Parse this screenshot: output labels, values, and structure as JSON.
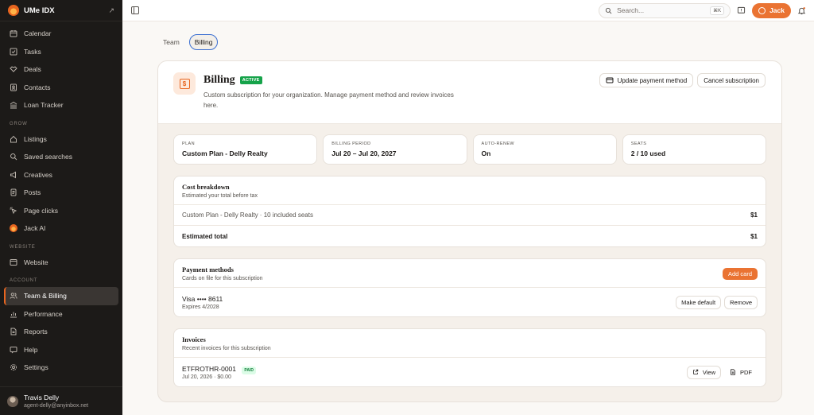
{
  "sidebar": {
    "brand": "UMe IDX",
    "items_main": [
      "Calendar",
      "Tasks",
      "Deals",
      "Contacts",
      "Loan Tracker"
    ],
    "section_grow": "GROW",
    "items_grow": [
      "Listings",
      "Saved searches",
      "Creatives",
      "Posts",
      "Page clicks",
      "Jack AI"
    ],
    "section_website": "WEBSITE",
    "items_website": [
      "Website"
    ],
    "section_account": "ACCOUNT",
    "items_account": [
      "Team & Billing",
      "Performance",
      "Reports",
      "Help",
      "Settings"
    ],
    "user": {
      "name": "Travis Delly",
      "email": "agent-delly@anyinbox.net"
    }
  },
  "topbar": {
    "search_placeholder": "Search...",
    "search_shortcut": "⌘K",
    "jack_label": "Jack"
  },
  "tabs": [
    "Team",
    "Billing"
  ],
  "billing": {
    "title": "Billing",
    "status": "ACTIVE",
    "subtitle": "Custom subscription for your organization. Manage payment method and review invoices here.",
    "update_btn": "Update payment method",
    "cancel_btn": "Cancel subscription",
    "stats": [
      {
        "label": "PLAN",
        "value": "Custom Plan - Delly Realty"
      },
      {
        "label": "BILLING PERIOD",
        "value": "Jul 20 – Jul 20, 2027"
      },
      {
        "label": "AUTO-RENEW",
        "value": "On"
      },
      {
        "label": "SEATS",
        "value": "2 / 10 used"
      }
    ],
    "cost": {
      "title": "Cost breakdown",
      "subtitle": "Estimated your total before tax",
      "line_label": "Custom Plan - Delly Realty · 10 included seats",
      "line_value": "$1",
      "total_label": "Estimated total",
      "total_value": "$1"
    },
    "payment": {
      "title": "Payment methods",
      "subtitle": "Cards on file for this subscription",
      "add_btn": "Add card",
      "card": "Visa •••• 8611",
      "expires": "Expires 4/2028",
      "default_btn": "Make default",
      "remove_btn": "Remove"
    },
    "invoices": {
      "title": "Invoices",
      "subtitle": "Recent invoices for this subscription",
      "number": "ETFROTHR-0001",
      "status": "PAID",
      "meta": "Jul 20, 2026 · $0.00",
      "view_btn": "View",
      "pdf_btn": "PDF"
    }
  }
}
